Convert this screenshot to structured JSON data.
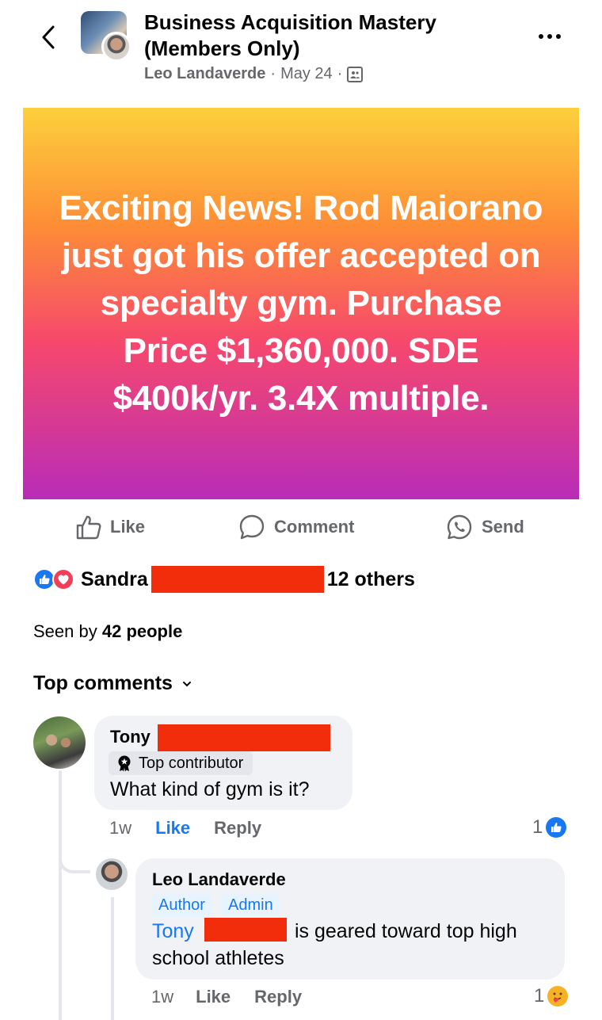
{
  "header": {
    "group_name": "Business Acquisition Mastery (Members Only)",
    "author": "Leo Landaverde",
    "separator": "·",
    "date": "May 24"
  },
  "post": {
    "banner_text": "Exciting News! Rod Maiorano just got his offer accepted on specialty gym. Purchase Price $1,360,000.  SDE $400k/yr. 3.4X multiple.",
    "banner_colors": [
      "#fdd03c",
      "#fd8d36",
      "#f6486d",
      "#b82cb8"
    ]
  },
  "actions": {
    "like": "Like",
    "comment": "Comment",
    "send": "Send"
  },
  "reactions": {
    "name": "Sandra",
    "others": "12 others"
  },
  "seen": {
    "prefix": "Seen by",
    "count": "42 people"
  },
  "comments_header": "Top comments",
  "comments": [
    {
      "name": "Tony",
      "badge": "Top contributor",
      "text": "What kind of gym is it?",
      "time": "1w",
      "like": "Like",
      "reply": "Reply",
      "reaction_count": "1"
    },
    {
      "name": "Leo Landaverde",
      "tags": [
        "Author",
        "Admin"
      ],
      "mention": "Tony",
      "text_line1": "is geared toward top high",
      "text_line2": "school athletes",
      "time": "1w",
      "like": "Like",
      "reply": "Reply",
      "reaction_count": "1"
    }
  ],
  "colors": {
    "accent": "#1877f2",
    "redaction": "#f22d0c",
    "muted_text": "#65676b",
    "bubble": "#f0f2f5"
  }
}
